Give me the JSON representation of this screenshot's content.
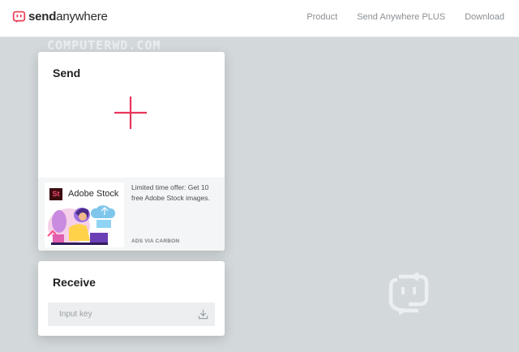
{
  "header": {
    "logo_bold": "send",
    "logo_light": "anywhere",
    "nav": [
      "Product",
      "Send Anywhere PLUS",
      "Download"
    ]
  },
  "watermark": "COMPUTERWD.COM",
  "send": {
    "title": "Send",
    "add_icon": "plus-icon",
    "ad": {
      "brand_logo": "St",
      "brand": "Adobe Stock",
      "text": "Limited time offer: Get 10 free Adobe Stock images.",
      "via": "ADS VIA CARBON"
    }
  },
  "receive": {
    "title": "Receive",
    "placeholder": "Input key",
    "download_icon": "download-icon"
  },
  "colors": {
    "accent": "#e8365d",
    "background": "#d3d8db",
    "logo_red": "#ea3a52"
  }
}
